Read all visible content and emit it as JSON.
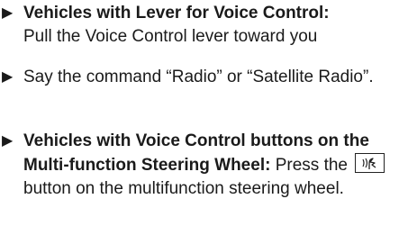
{
  "marker": "▶",
  "steps": [
    {
      "heading": "Vehicles with Lever for Voice Control:",
      "text": "Pull the Voice Control lever toward you"
    },
    {
      "text": "Say the command “Radio” or “Satellite Radio”."
    },
    {
      "heading": "Vehicles with Voice Control buttons on the Multi-function Steering Wheel:",
      "text_before": "Press the",
      "button_icon": "voice-control-icon",
      "text_after": "button on the multifunction steering wheel."
    }
  ]
}
